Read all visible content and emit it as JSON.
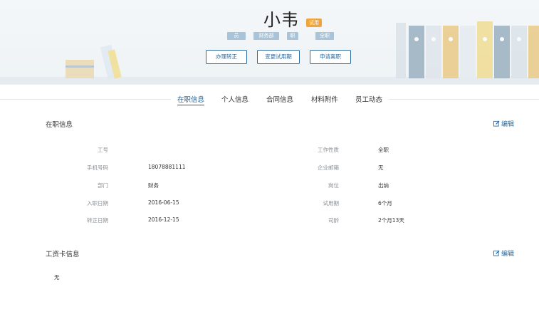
{
  "profile": {
    "name": "小韦",
    "status": "试用",
    "tags": [
      "员",
      "财务部",
      "职",
      "全职"
    ],
    "actions": [
      "办理转正",
      "变更试用期",
      "申请离职"
    ]
  },
  "tabs": [
    "在职信息",
    "个人信息",
    "合同信息",
    "材料附件",
    "员工动态"
  ],
  "employment": {
    "title": "在职信息",
    "edit_label": "编辑",
    "left_fields": [
      {
        "label": "工号",
        "value": ""
      },
      {
        "label": "手机号码",
        "value": "18078881111"
      },
      {
        "label": "部门",
        "value": "财务"
      },
      {
        "label": "入职日期",
        "value": "2016-06-15"
      },
      {
        "label": "转正日期",
        "value": "2016-12-15"
      }
    ],
    "right_fields": [
      {
        "label": "工作性质",
        "value": "全职"
      },
      {
        "label": "企业邮箱",
        "value": "无"
      },
      {
        "label": "岗位",
        "value": "出纳"
      },
      {
        "label": "试用期",
        "value": "6个月"
      },
      {
        "label": "司龄",
        "value": "2个月13天"
      }
    ]
  },
  "salary_card": {
    "title": "工资卡信息",
    "edit_label": "编辑",
    "content": "无"
  },
  "colors": {
    "accent": "#2c6aa0",
    "badge": "#f0a43a",
    "tag": "#a9c4d8"
  }
}
